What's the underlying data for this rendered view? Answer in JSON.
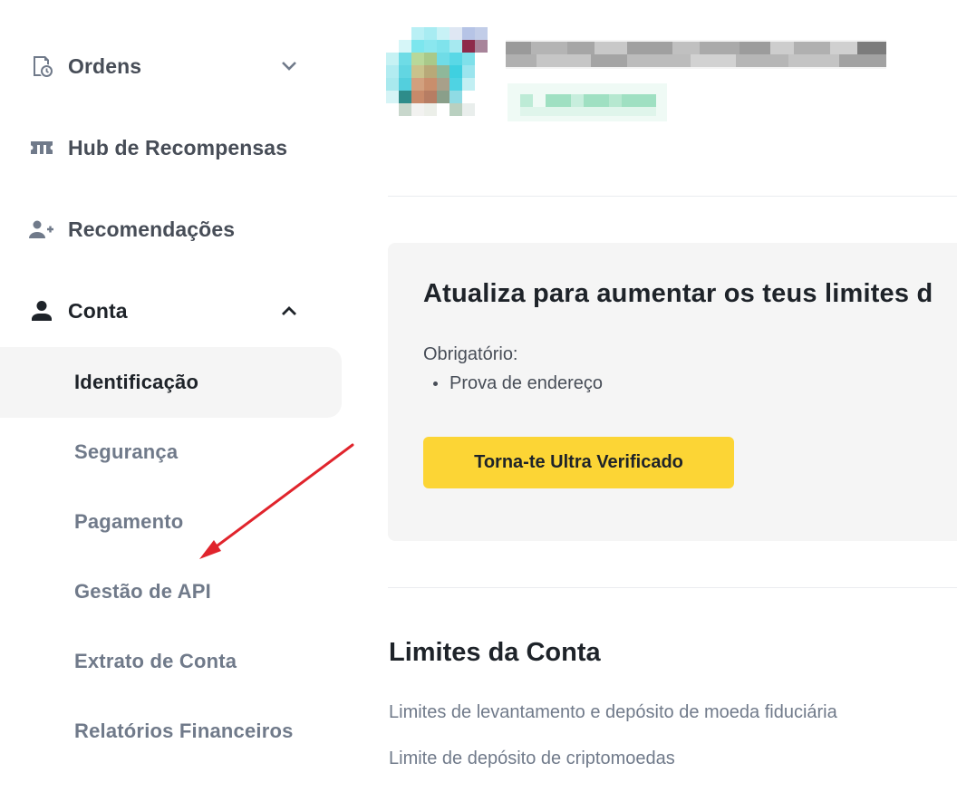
{
  "sidebar": {
    "items": [
      {
        "label": "Ordens",
        "icon": "orders-icon"
      },
      {
        "label": "Hub de Recompensas",
        "icon": "ticket-icon"
      },
      {
        "label": "Recomendações",
        "icon": "add-user-icon"
      },
      {
        "label": "Conta",
        "icon": "user-icon"
      }
    ],
    "account_sub": [
      "Identificação",
      "Segurança",
      "Pagamento",
      "Gestão de API",
      "Extrato de Conta",
      "Relatórios Financeiros"
    ],
    "selected_sub": "Identificação"
  },
  "profile": {
    "name_obscured": true,
    "id_obscured": true
  },
  "upgrade_card": {
    "title": "Atualiza para aumentar os teus limites d",
    "required_label": "Obrigatório:",
    "requirements": [
      "Prova de endereço"
    ],
    "cta_label": "Torna-te Ultra Verificado"
  },
  "limits": {
    "title": "Limites da Conta",
    "links": [
      "Limites de levantamento e depósito de moeda fiduciária",
      "Limite de depósito de criptomoedas"
    ]
  },
  "colors": {
    "accent": "#fcd535",
    "annotation_arrow": "#e0242c",
    "selected_bg": "#f5f5f5"
  }
}
